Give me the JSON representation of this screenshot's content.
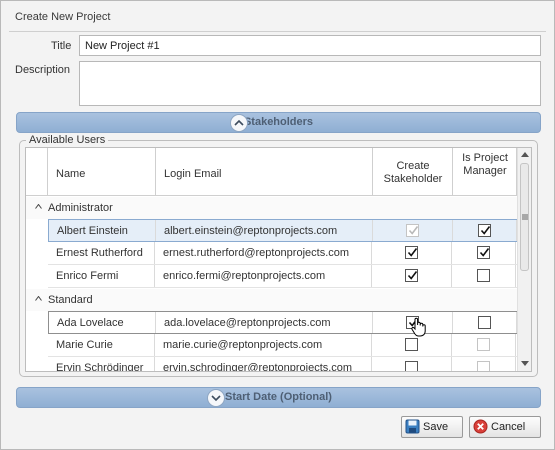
{
  "window": {
    "title": "Create New Project"
  },
  "form": {
    "title_label": "Title",
    "title_value": "New Project #1",
    "description_label": "Description",
    "description_value": ""
  },
  "stakeholders_band": {
    "label": "Stakeholders"
  },
  "users_group": {
    "legend": "Available Users"
  },
  "grid": {
    "columns": {
      "name": "Name",
      "email": "Login Email",
      "create": "Create Stakeholder",
      "manager": "Is Project Manager"
    },
    "groups": [
      {
        "label": "Administrator",
        "rows": [
          {
            "name": "Albert Einstein",
            "email": "albert.einstein@reptonprojects.com",
            "create": "checked-disabled",
            "manager": "checked"
          },
          {
            "name": "Ernest Rutherford",
            "email": "ernest.rutherford@reptonprojects.com",
            "create": "checked",
            "manager": "checked"
          },
          {
            "name": "Enrico Fermi",
            "email": "enrico.fermi@reptonprojects.com",
            "create": "checked",
            "manager": "unchecked"
          }
        ]
      },
      {
        "label": "Standard",
        "rows": [
          {
            "name": "Ada Lovelace",
            "email": "ada.lovelace@reptonprojects.com",
            "create": "checked",
            "manager": "unchecked"
          },
          {
            "name": "Marie Curie",
            "email": "marie.curie@reptonprojects.com",
            "create": "unchecked",
            "manager": "disabled"
          },
          {
            "name": "Ervin Schrödinger",
            "email": "ervin.schrodinger@reptonprojects.com",
            "create": "unchecked",
            "manager": "disabled"
          }
        ]
      }
    ]
  },
  "start_date_band": {
    "label": "Start Date (Optional)"
  },
  "buttons": {
    "save": "Save",
    "cancel": "Cancel"
  },
  "colors": {
    "band": "#9db8da",
    "selected_row": "#e5eef8",
    "cancel_icon": "#d9403a",
    "save_icon": "#3a7fc1"
  }
}
